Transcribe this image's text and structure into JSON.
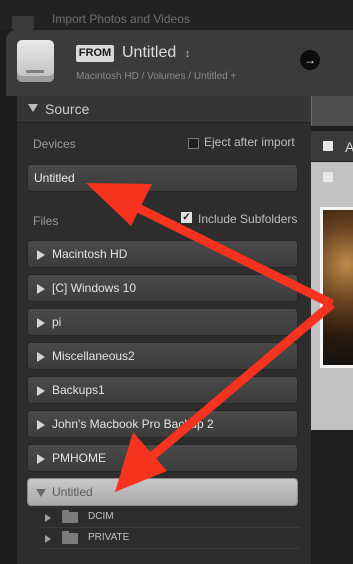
{
  "window": {
    "title": "Import Photos and Videos"
  },
  "header": {
    "from_badge": "FROM",
    "source_name": "Untitled",
    "source_caret": "↕",
    "source_path": "Macintosh HD / Volumes / Untitled +",
    "go_icon": "→"
  },
  "source_panel": {
    "title": "Source",
    "devices_label": "Devices",
    "eject_label": "Eject after import",
    "eject_checked": false,
    "device": "Untitled",
    "files_label": "Files",
    "include_subfolders_label": "Include Subfolders",
    "include_subfolders_checked": true,
    "volumes": [
      {
        "label": "Macintosh HD"
      },
      {
        "label": "[C] Windows 10"
      },
      {
        "label": "pi"
      },
      {
        "label": "Miscellaneous2"
      },
      {
        "label": "Backups1"
      },
      {
        "label": "John's Macbook Pro Backup 2"
      },
      {
        "label": "PMHOME"
      },
      {
        "label": "Untitled",
        "selected": true,
        "expanded": true
      }
    ],
    "children": [
      {
        "label": "DCIM"
      },
      {
        "label": "PRIVATE"
      }
    ]
  },
  "grid": {
    "header_label": "A"
  },
  "annotation": {
    "arrow_color": "#f5331f"
  }
}
